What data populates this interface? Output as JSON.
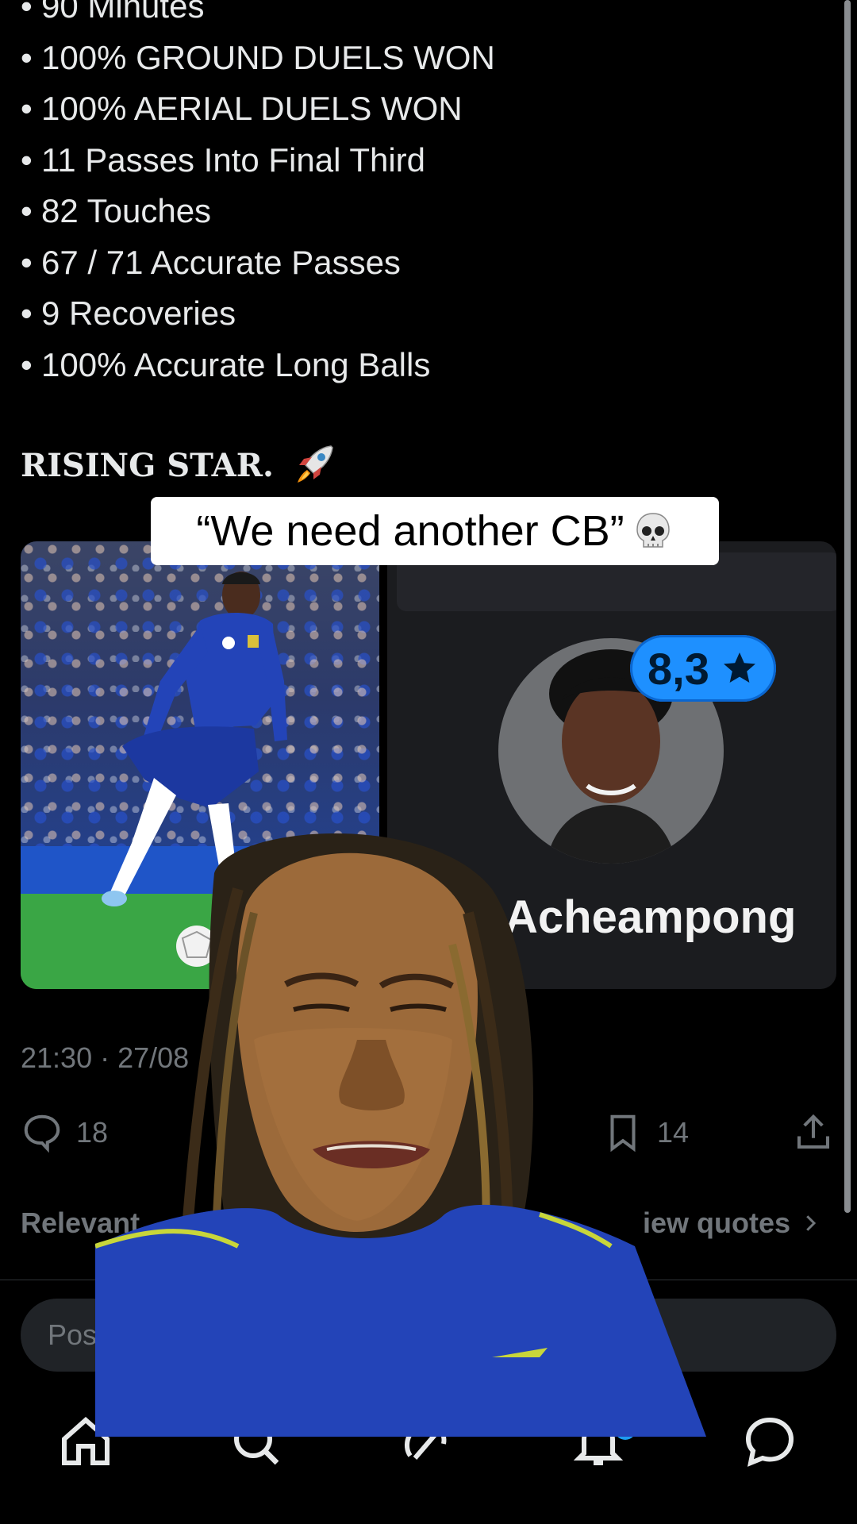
{
  "post": {
    "stats": [
      "90 Minutes",
      "100% GROUND DUELS WON",
      "100% AERIAL DUELS WON",
      "11 Passes Into Final Third",
      "82 Touches",
      "67 / 71 Accurate Passes",
      "9 Recoveries",
      "100% Accurate Long Balls"
    ],
    "bullet": "•",
    "headline": "RISING STAR.",
    "rating": "8,3",
    "player_name_partial": "Acheampong",
    "timestamp": "21:30 · 27/08",
    "replies": "18",
    "bookmarks": "14"
  },
  "caption": {
    "text": "“We need another CB”"
  },
  "tabs": {
    "relevant": "Relevant",
    "view_quotes": "iew quotes"
  },
  "reply_box": {
    "placeholder": "Pos"
  },
  "colors": {
    "accent": "#1d9bf0",
    "rating_badge": "#1e90ff",
    "muted_text": "#71767b",
    "kit_blue": "#2344b8"
  }
}
